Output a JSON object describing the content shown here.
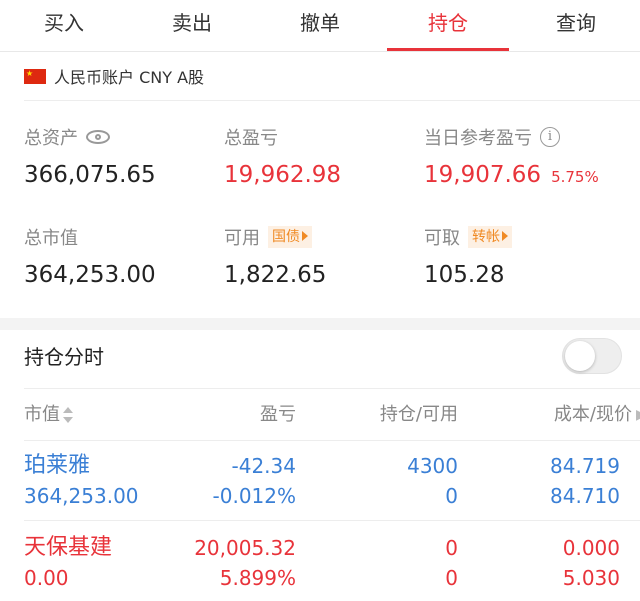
{
  "tabs": [
    {
      "label": "买入",
      "active": false
    },
    {
      "label": "卖出",
      "active": false
    },
    {
      "label": "撤单",
      "active": false
    },
    {
      "label": "持仓",
      "active": true
    },
    {
      "label": "查询",
      "active": false
    }
  ],
  "account": {
    "flag_icon": "cn-flag-icon",
    "label": "人民币账户 CNY A股"
  },
  "summary": {
    "total_assets_label": "总资产",
    "total_assets": "366,075.65",
    "total_pnl_label": "总盈亏",
    "total_pnl": "19,962.98",
    "daily_pnl_label": "当日参考盈亏",
    "daily_pnl": "19,907.66",
    "daily_pnl_pct": "5.75%",
    "market_value_label": "总市值",
    "market_value": "364,253.00",
    "available_label": "可用",
    "available_tag": "国债",
    "available": "1,822.65",
    "withdrawable_label": "可取",
    "withdrawable_tag": "转帐",
    "withdrawable": "105.28"
  },
  "positions_section": {
    "title": "持仓分时",
    "toggle_on": false
  },
  "table": {
    "headers": {
      "market_value": "市值",
      "pnl": "盈亏",
      "position": "持仓/可用",
      "cost": "成本/现价"
    },
    "rows": [
      {
        "name": "珀莱雅",
        "market_value": "364,253.00",
        "pnl": "-42.34",
        "pnl_pct": "-0.012%",
        "position": "4300",
        "available": "0",
        "cost": "84.719",
        "price": "84.710",
        "color": "#3a7fd5"
      },
      {
        "name": "天保基建",
        "market_value": "0.00",
        "pnl": "20,005.32",
        "pnl_pct": "5.899%",
        "position": "0",
        "available": "0",
        "cost": "0.000",
        "price": "5.030",
        "color": "#e8333a"
      }
    ]
  },
  "colors": {
    "accent": "#e8333a",
    "down": "#3a7fd5",
    "tag": "#f08a24"
  }
}
